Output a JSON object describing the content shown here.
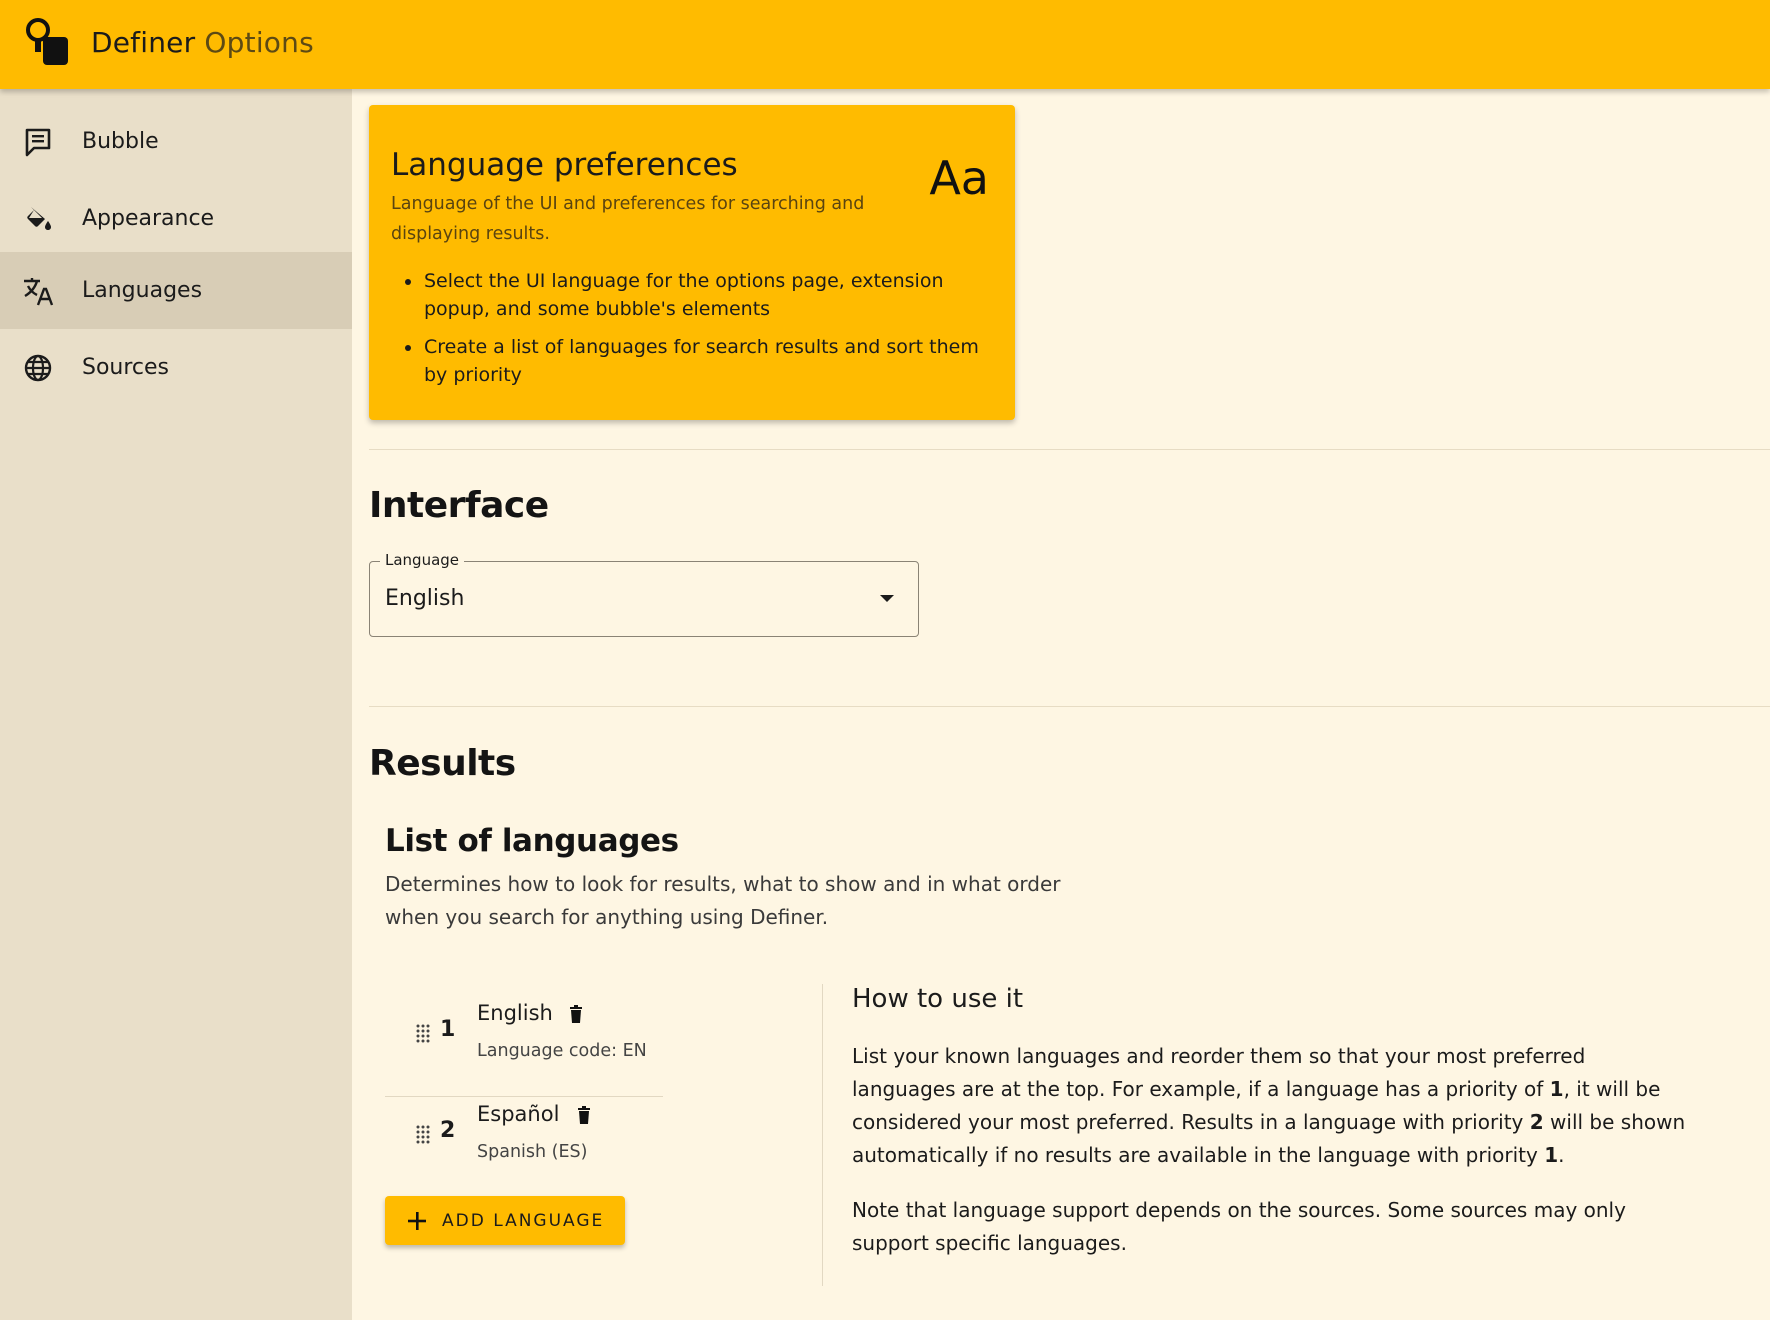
{
  "app": {
    "title_main": "Definer",
    "title_sub": "Options"
  },
  "sidebar": {
    "items": [
      {
        "label": "Bubble",
        "icon": "chat-bubble-icon",
        "active": false
      },
      {
        "label": "Appearance",
        "icon": "paint-bucket-icon",
        "active": false
      },
      {
        "label": "Languages",
        "icon": "translate-icon",
        "active": true
      },
      {
        "label": "Sources",
        "icon": "globe-icon",
        "active": false
      }
    ]
  },
  "card": {
    "title": "Language preferences",
    "aa": "Aa",
    "subtitle": "Language of the UI and preferences for searching and displaying results.",
    "bullets": [
      "Select the UI language for the options page, extension popup, and some bubble's elements",
      "Create a list of languages for search results and sort them by priority"
    ]
  },
  "interface": {
    "heading": "Interface",
    "select_label": "Language",
    "select_value": "English"
  },
  "results": {
    "heading": "Results",
    "list_title": "List of languages",
    "list_desc": "Determines how to look for results, what to show and in what order when you search for anything using Definer.",
    "languages": [
      {
        "priority": "1",
        "name": "English",
        "detail": "Language code: EN"
      },
      {
        "priority": "2",
        "name": "Español",
        "detail": "Spanish (ES)"
      }
    ],
    "add_button": "ADD LANGUAGE"
  },
  "howto": {
    "title": "How to use it",
    "p1_a": "List your known languages and reorder them so that your most preferred languages are at the top. For example, if a language has a priority of ",
    "p1_b": "1",
    "p1_c": ", it will be considered your most preferred. Results in a language with priority ",
    "p1_d": "2",
    "p1_e": " will be shown automatically if no results are available in the language with priority ",
    "p1_f": "1",
    "p1_g": ".",
    "p2": "Note that language support depends on the sources. Some sources may only support specific languages."
  },
  "colors": {
    "accent": "#ffbb00",
    "background": "#fef6e3",
    "sidebar": "#e9dfc9",
    "sidebar_active": "#d8cdb6"
  }
}
